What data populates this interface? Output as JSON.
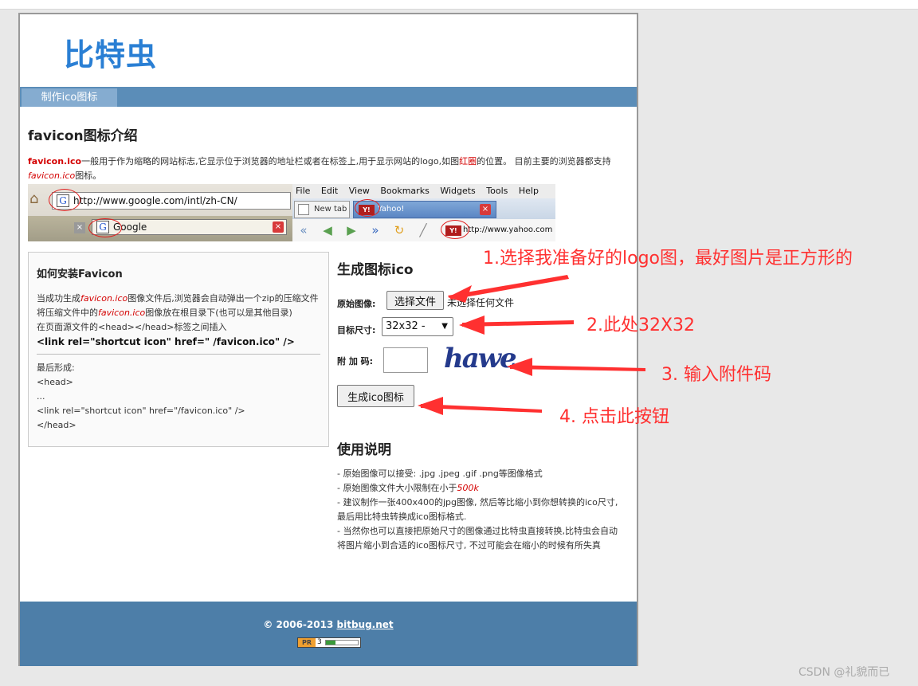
{
  "site": {
    "logo": "比特虫",
    "nav_tab": "制作ico图标"
  },
  "intro": {
    "title": "favicon图标介绍",
    "text_bold": "favicon.ico",
    "text_1": "一般用于作为缩略的网站标志,它显示位于浏览器的地址栏或者在标签上,用于显示网站的logo,如图",
    "text_red": "红圈",
    "text_2": "的位置。 目前主要的浏览器都支持",
    "text_italic": "favicon.ico",
    "text_3": "图标。"
  },
  "screenshot": {
    "google_url": "http://www.google.com/intl/zh-CN/",
    "google_tab": "Google",
    "menu": [
      "File",
      "Edit",
      "View",
      "Bookmarks",
      "Widgets",
      "Tools",
      "Help"
    ],
    "new_tab": "New tab",
    "yahoo_tab": "Yahoo!",
    "yahoo_url": "http://www.yahoo.com"
  },
  "install_box": {
    "title": "如何安装Favicon",
    "line1_a": "当成功生成",
    "line1_i": "favicon.ico",
    "line1_b": "图像文件后,浏览器会自动弹出一个zip的压缩文件",
    "line2_a": "将压缩文件中的",
    "line2_i": "favicon.ico",
    "line2_b": "图像放在根目录下(也可以是其他目录)",
    "line3": "在页面源文件的<head></head>标签之间插入",
    "code": "<link rel=\"shortcut icon\" href=\" /favicon.ico\" />",
    "result_label": "最后形成:",
    "r1": "<head>",
    "r2": "...",
    "r3": "<link rel=\"shortcut icon\" href=\"/favicon.ico\" />",
    "r4": "</head>"
  },
  "form": {
    "title": "生成图标ico",
    "source_label": "原始图像:",
    "choose_button": "选择文件",
    "no_file": "未选择任何文件",
    "size_label": "目标尺寸:",
    "size_value": "32x32 -",
    "code_label": "附 加 码:",
    "captcha": "hawe",
    "submit_button": "生成ico图标"
  },
  "usage": {
    "title": "使用说明",
    "l1": "- 原始图像可以接受: .jpg .jpeg .gif .png等图像格式",
    "l2_a": "- 原始图像文件大小限制在小于",
    "l2_i": "500k",
    "l3": "- 建议制作一张400x400的jpg图像, 然后等比缩小到你想转换的ico尺寸,最后用比特虫转换成ico图标格式.",
    "l4": "- 当然你也可以直接把原始尺寸的图像通过比特虫直接转换,比特虫会自动将图片缩小到合适的ico图标尺寸, 不过可能会在缩小的时候有所失真"
  },
  "footer": {
    "copyright": "© 2006-2013 ",
    "link": "bitbug.net",
    "pr_label": "PR",
    "pr_value": "3",
    "pr_fraction": 0.3
  },
  "annotations": {
    "a1": "1.选择我准备好的logo图，最好图片是正方形的",
    "a2": "2.此处32X32",
    "a3": "3. 输入附件码",
    "a4": "4. 点击此按钮"
  },
  "watermark": "CSDN @礼貌而已",
  "colors": {
    "logo": "#2a7fd4",
    "nav": "#5b8db8",
    "footer": "#4d7ea8",
    "annotation": "#ff3030"
  }
}
